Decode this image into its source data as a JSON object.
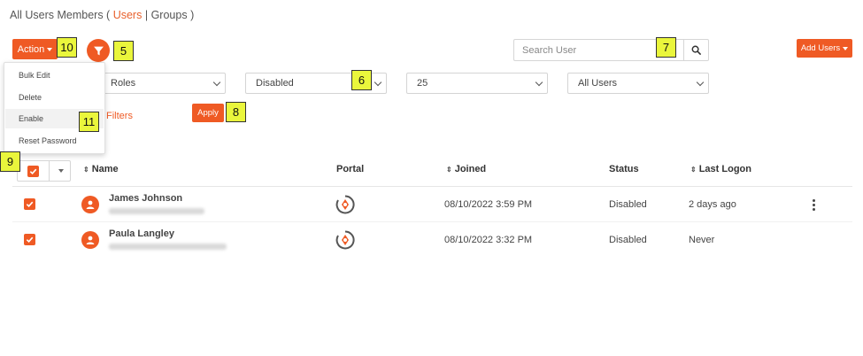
{
  "breadcrumb": {
    "prefix": "All Users Members (",
    "users": "Users",
    "sep": "|",
    "groups": "Groups",
    "suffix": ")"
  },
  "toolbar": {
    "action_label": "Action",
    "search_placeholder": "Search User",
    "add_users_label": "Add Users"
  },
  "filters": {
    "roles": "Roles",
    "status": "Disabled",
    "per_page": "25",
    "user_scope": "All Users",
    "clear_label": "Filters",
    "apply_label": "Apply"
  },
  "action_menu": {
    "items": [
      "Bulk Edit",
      "Delete",
      "Enable",
      "Reset Password"
    ]
  },
  "annotations": [
    "5",
    "6",
    "7",
    "8",
    "9",
    "10",
    "11"
  ],
  "table": {
    "columns": {
      "name": "Name",
      "portal": "Portal",
      "joined": "Joined",
      "status": "Status",
      "last_logon": "Last Logon"
    },
    "rows": [
      {
        "name": "James Johnson",
        "joined": "08/10/2022 3:59 PM",
        "status": "Disabled",
        "last_logon": "2 days ago"
      },
      {
        "name": "Paula Langley",
        "joined": "08/10/2022 3:32 PM",
        "status": "Disabled",
        "last_logon": "Never"
      }
    ]
  },
  "colors": {
    "accent": "#ef5a24",
    "annotation": "#eaf63c"
  }
}
